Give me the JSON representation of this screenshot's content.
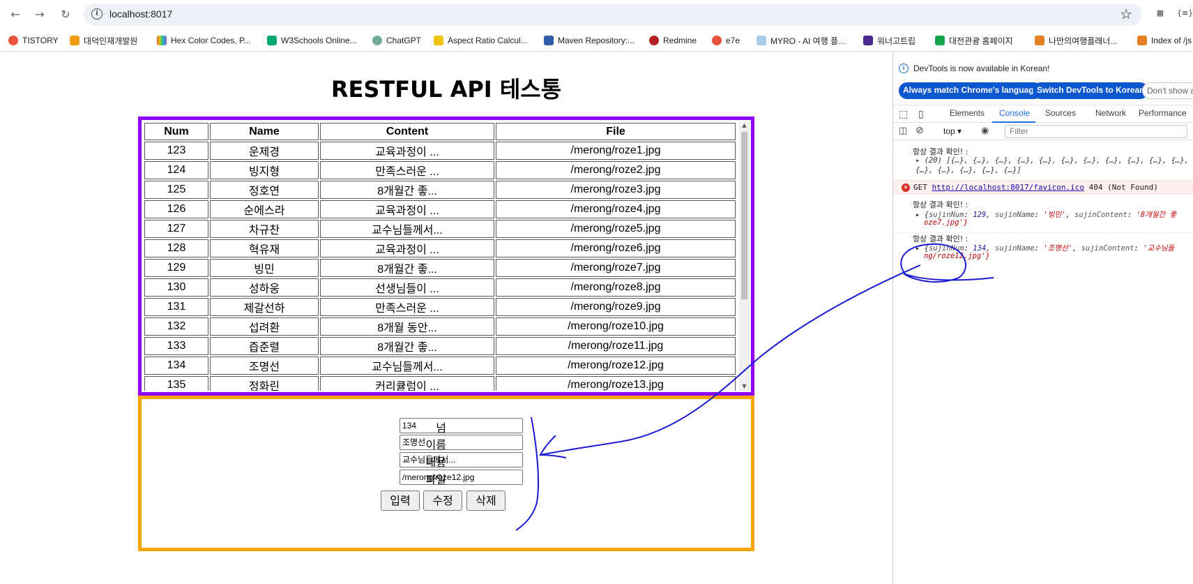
{
  "browser": {
    "url": "localhost:8017",
    "bookmarks": [
      {
        "label": "TISTORY",
        "color": "#e8553a"
      },
      {
        "label": "대덕인재개발원",
        "color": "#f39c12"
      },
      {
        "label": "Hex Color Codes, P...",
        "color": "#6a4bc4"
      },
      {
        "label": "W3Schools Online...",
        "color": "#04aa6d"
      },
      {
        "label": "ChatGPT",
        "color": "#74aa9c"
      },
      {
        "label": "Aspect Ratio Calcul...",
        "color": "#f1c40f"
      },
      {
        "label": "Maven Repository:...",
        "color": "#2e5aa8"
      },
      {
        "label": "Redmine",
        "color": "#b32024"
      },
      {
        "label": "e7e",
        "color": "#e8553a"
      },
      {
        "label": "MYRO - AI 여행 플...",
        "color": "#a9cde8"
      },
      {
        "label": "워너고트립",
        "color": "#4b2a8f"
      },
      {
        "label": "대전관광 홈페이지",
        "color": "#16a34a"
      },
      {
        "label": "나만의여행플래너...",
        "color": "#e67e22"
      },
      {
        "label": "Index of /js",
        "color": "#e67e22"
      }
    ]
  },
  "page": {
    "title": "RESTFUL API 테스통",
    "table": {
      "headers": [
        "Num",
        "Name",
        "Content",
        "File"
      ],
      "rows": [
        [
          "123",
          "운제경",
          "교육과정이 ...",
          "/merong/roze1.jpg"
        ],
        [
          "124",
          "빙지형",
          "만족스러운 ...",
          "/merong/roze2.jpg"
        ],
        [
          "125",
          "정호연",
          "8개월간 좋...",
          "/merong/roze3.jpg"
        ],
        [
          "126",
          "순에스라",
          "교육과정이 ...",
          "/merong/roze4.jpg"
        ],
        [
          "127",
          "차규찬",
          "교수님들께서...",
          "/merong/roze5.jpg"
        ],
        [
          "128",
          "혁유재",
          "교육과정이 ...",
          "/merong/roze6.jpg"
        ],
        [
          "129",
          "빙민",
          "8개월간 좋...",
          "/merong/roze7.jpg"
        ],
        [
          "130",
          "성하웅",
          "선생님들이 ...",
          "/merong/roze8.jpg"
        ],
        [
          "131",
          "제갈선하",
          "만족스러운 ...",
          "/merong/roze9.jpg"
        ],
        [
          "132",
          "섭려환",
          "8개월 동안...",
          "/merong/roze10.jpg"
        ],
        [
          "133",
          "즙준렬",
          "8개월간 좋...",
          "/merong/roze11.jpg"
        ],
        [
          "134",
          "조명선",
          "교수님들께서...",
          "/merong/roze12.jpg"
        ],
        [
          "135",
          "정화린",
          "커리큘럼이 ...",
          "/merong/roze13.jpg"
        ]
      ]
    },
    "form": {
      "num_label": "넘",
      "num_value": "134",
      "name_label": "이름",
      "name_value": "조명선",
      "content_label": "내용",
      "content_value": "교수님들께서...",
      "file_label": "파일",
      "file_value": "/merong/roze12.jpg",
      "insert_label": "입력",
      "update_label": "수정",
      "delete_label": "삭제"
    }
  },
  "devtools": {
    "info_text": "DevTools is now available in Korean!",
    "btn_match": "Always match Chrome's language",
    "btn_switch": "Switch DevTools to Korean",
    "btn_dont": "Don't show a",
    "tabs": [
      "Elements",
      "Console",
      "Sources",
      "Network",
      "Performance"
    ],
    "active_tab": "Console",
    "context": "top",
    "filter_placeholder": "Filter",
    "console": {
      "log1_label": "항상 결과 확인! :",
      "log1_line1": "▸ (20) [{…}, {…}, {…}, {…}, {…}, {…}, {…}, {…}, {…}, {…}, {…},",
      "log1_line2": "  {…}, {…}, {…}, {…}, {…}]",
      "error_method": "GET",
      "error_url": "http://localhost:8017/favicon.ico",
      "error_status": "404 (Not Found)",
      "log2_label": "항상 결과 확인! :",
      "log2_num": "129",
      "log2_name": "'빙민'",
      "log2_content": "'8개월간 좋",
      "log2_tail": "oze7.jpg'}",
      "log3_label": "항상 결과 확인! :",
      "log3_num": "134",
      "log3_name": "'조명선'",
      "log3_content": "'교수님들",
      "log3_tail": "ng/roze12.jpg'}"
    }
  }
}
